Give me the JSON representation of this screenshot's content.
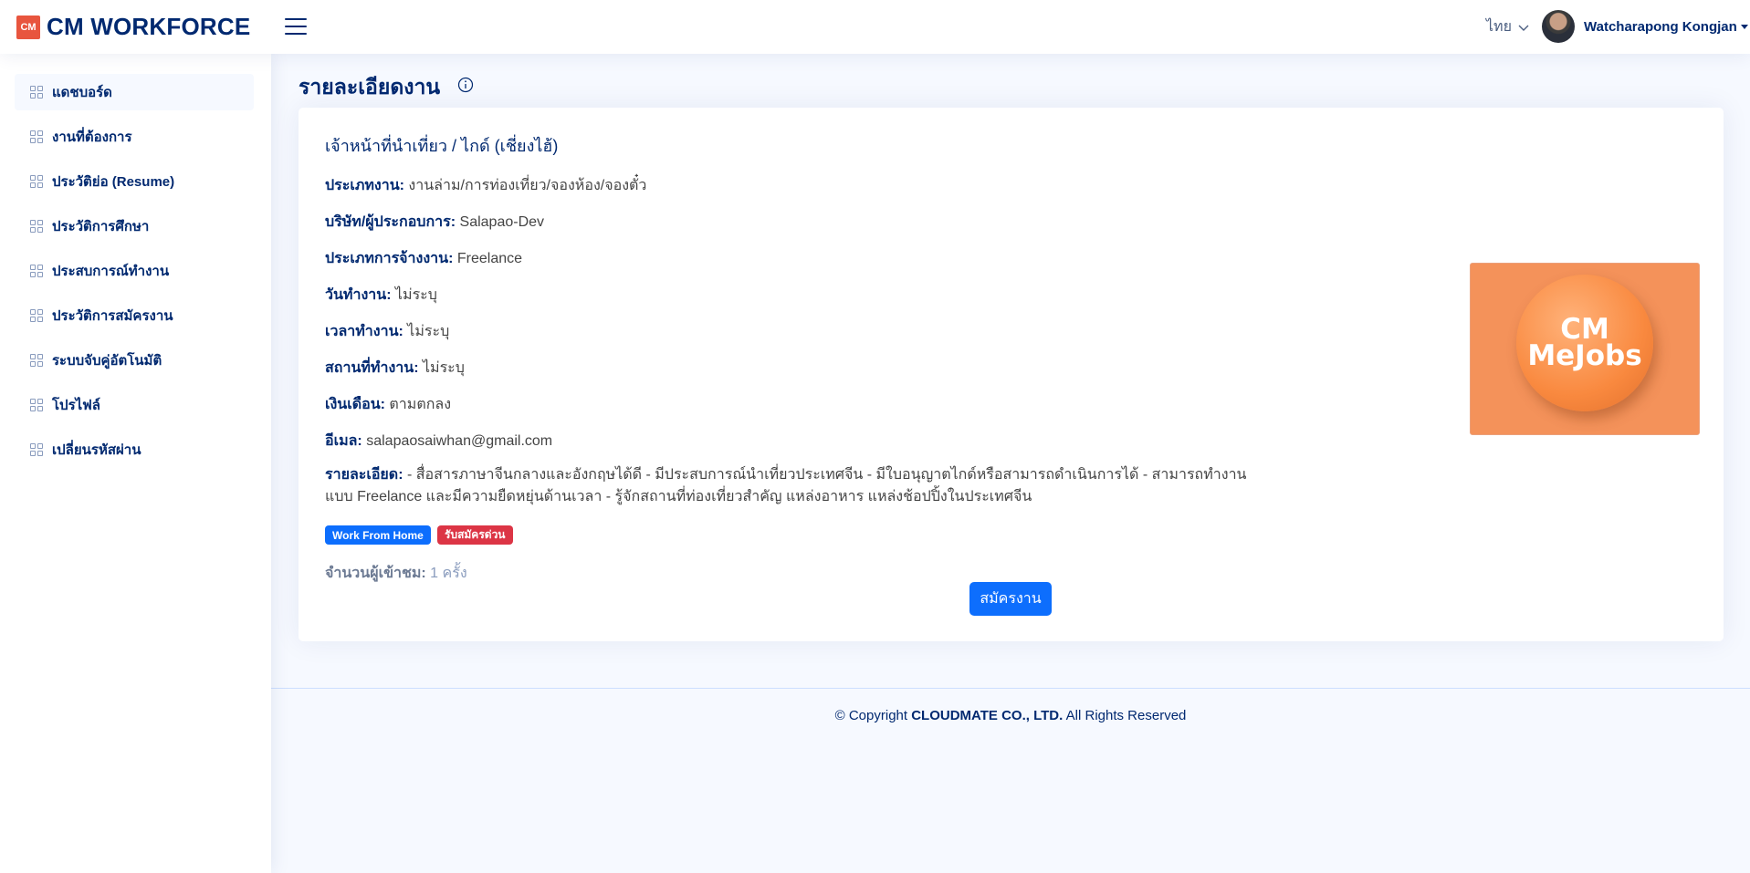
{
  "header": {
    "logo_mark": "CM",
    "logo_text": "CM WORKFORCE",
    "language": "ไทย",
    "user_name": "Watcharapong Kongjan"
  },
  "sidebar": {
    "items": [
      {
        "label": "แดชบอร์ด"
      },
      {
        "label": "งานที่ต้องการ"
      },
      {
        "label": "ประวัติย่อ (Resume)"
      },
      {
        "label": "ประวัติการศึกษา"
      },
      {
        "label": "ประสบการณ์ทำงาน"
      },
      {
        "label": "ประวัติการสมัครงาน"
      },
      {
        "label": "ระบบจับคู่อัตโนมัติ"
      },
      {
        "label": "โปรไฟล์"
      },
      {
        "label": "เปลี่ยนรหัสผ่าน"
      }
    ]
  },
  "page": {
    "title": "รายละเอียดงาน"
  },
  "job": {
    "title": "เจ้าหน้าที่นำเที่ยว / ไกด์ (เชี่ยงไฮ้)",
    "fields": [
      {
        "label": "ประเภทงาน:",
        "value": "งานล่าม/การท่องเที่ยว/จองห้อง/จองตั๋ว"
      },
      {
        "label": "บริษัท/ผู้ประกอบการ:",
        "value": "Salapao-Dev"
      },
      {
        "label": "ประเภทการจ้างงาน:",
        "value": "Freelance"
      },
      {
        "label": "วันทำงาน:",
        "value": "ไม่ระบุ"
      },
      {
        "label": "เวลาทำงาน:",
        "value": "ไม่ระบุ"
      },
      {
        "label": "สถานที่ทำงาน:",
        "value": "ไม่ระบุ"
      },
      {
        "label": "เงินเดือน:",
        "value": "ตามตกลง"
      },
      {
        "label": "อีเมล:",
        "value": "salapaosaiwhan@gmail.com"
      }
    ],
    "detail_label": "รายละเอียด:",
    "detail_value": "- สื่อสารภาษาจีนกลางและอังกฤษได้ดี - มีประสบการณ์นำเที่ยวประเทศจีน - มีใบอนุญาตไกด์หรือสามารถดำเนินการได้ - สามารถทำงานแบบ Freelance และมีความยืดหยุ่นด้านเวลา - รู้จักสถานที่ท่องเที่ยวสำคัญ แหล่งอาหาร แหล่งช้อปปิ้งในประเทศจีน",
    "badges": [
      "Work From Home",
      "รับสมัครด่วน"
    ],
    "views_label": "จำนวนผู้เข้าชม:",
    "views_value": "1 ครั้ง",
    "apply_label": "สมัครงาน",
    "image_text_line1": "CM",
    "image_text_line2": "MeJobs"
  },
  "footer": {
    "prefix": "© Copyright",
    "company": "CLOUDMATE CO., LTD.",
    "suffix": "All Rights Reserved"
  },
  "colors": {
    "primary": "#012970",
    "accent_blue": "#0d6efd",
    "badge_red": "#dc3545",
    "logo_red": "#e8553e",
    "image_orange": "#f4925a",
    "background": "#f6f9ff"
  }
}
